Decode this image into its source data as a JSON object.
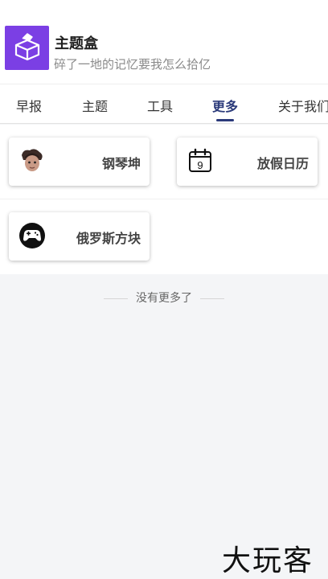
{
  "app": {
    "title": "主题盒",
    "subtitle": "碎了一地的记忆要我怎么拾亿"
  },
  "tabs": [
    {
      "label": "早报",
      "active": false
    },
    {
      "label": "主题",
      "active": false
    },
    {
      "label": "工具",
      "active": false
    },
    {
      "label": "更多",
      "active": true
    },
    {
      "label": "关于我们",
      "active": false
    }
  ],
  "cards": [
    {
      "label": "钢琴坤",
      "icon": "avatar-icon"
    },
    {
      "label": "放假日历",
      "icon": "calendar-icon",
      "icon_text": "9"
    },
    {
      "label": "俄罗斯方块",
      "icon": "gamepad-icon"
    }
  ],
  "footer": {
    "note": "没有更多了"
  },
  "watermark": "大玩客",
  "colors": {
    "brand": "#7b3fe4",
    "active_tab": "#2b3a7a"
  }
}
